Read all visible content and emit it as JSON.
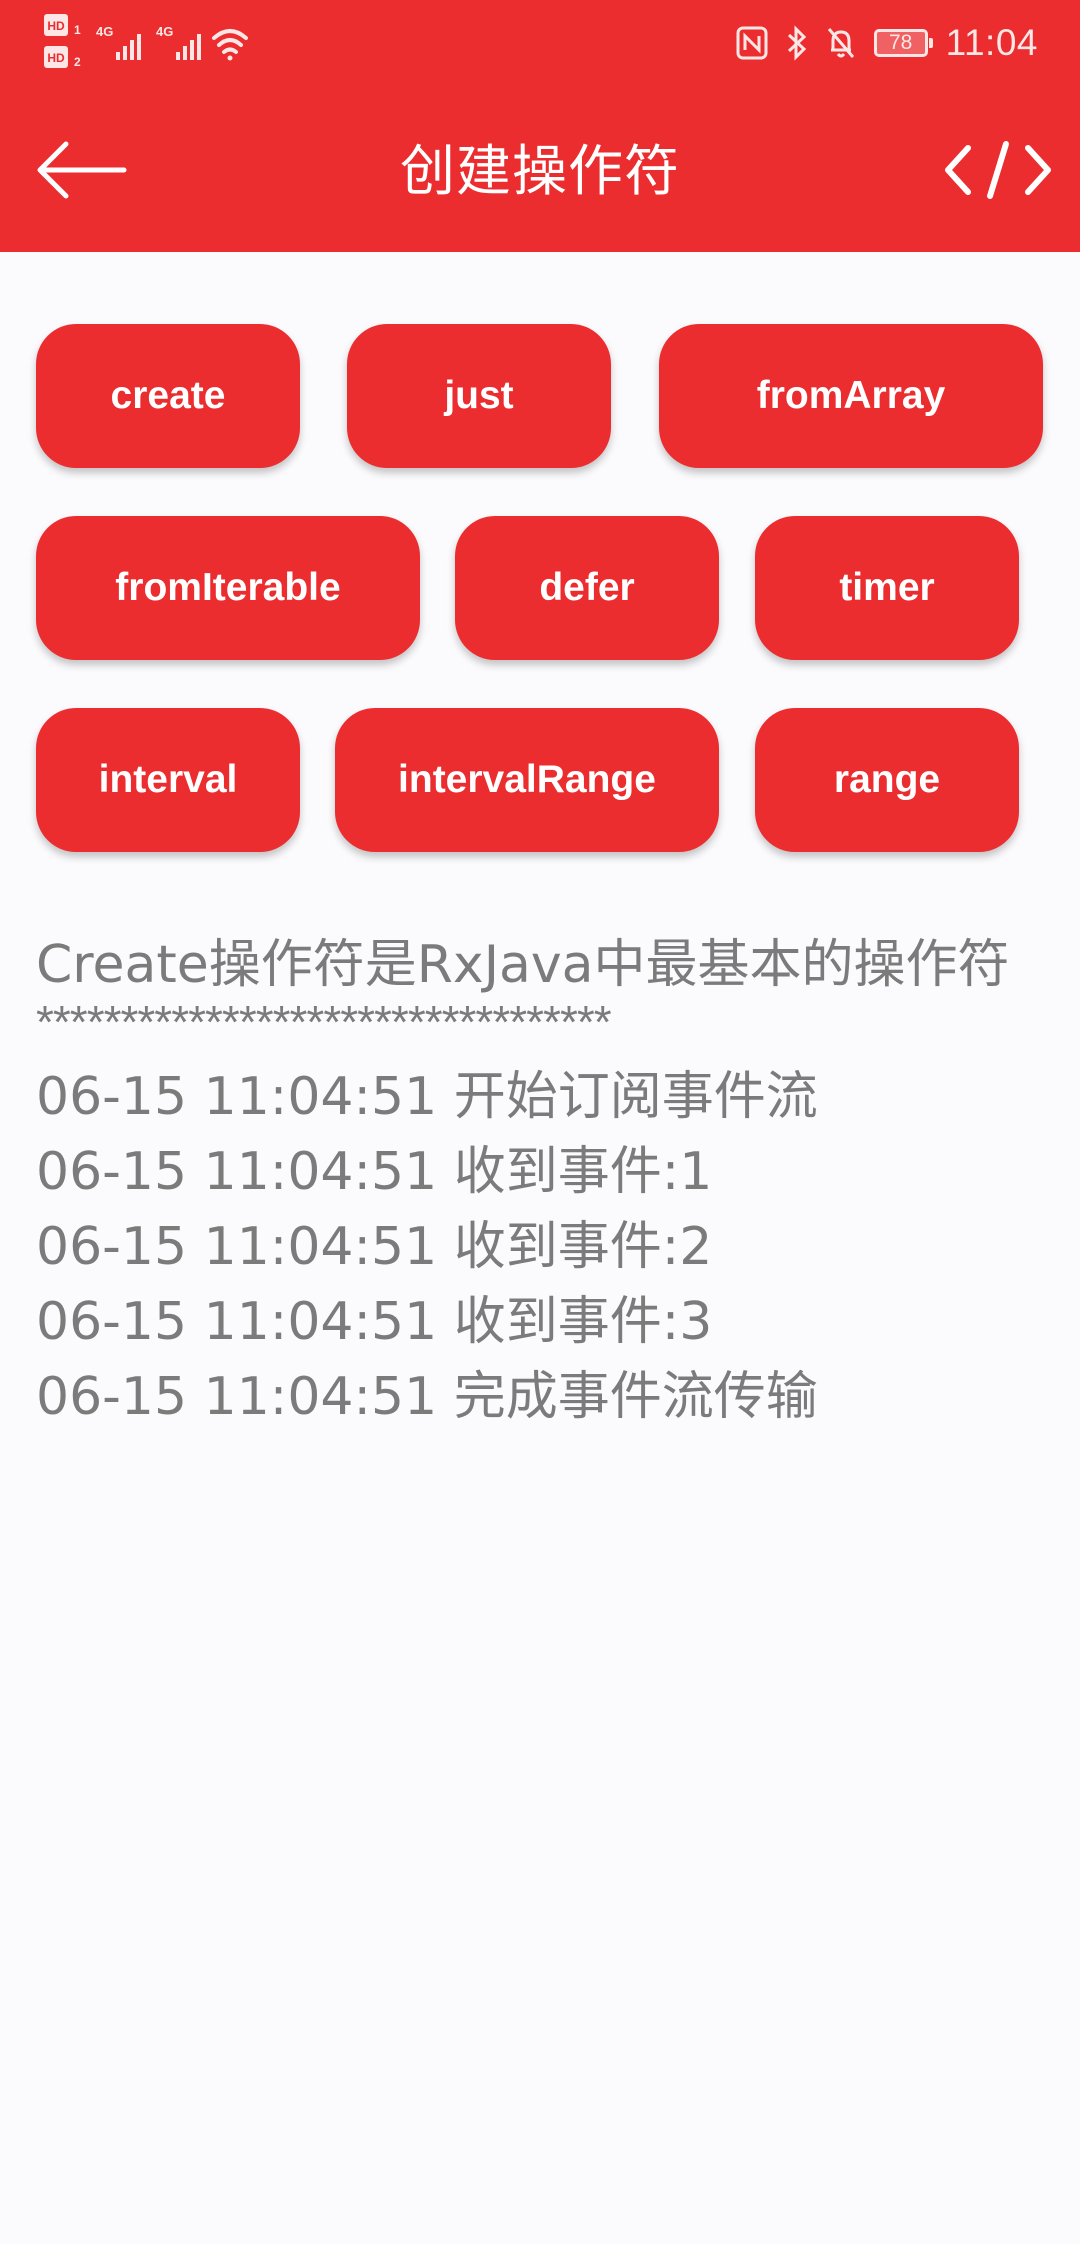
{
  "status_bar": {
    "time": "11:04",
    "battery": "78",
    "sim1_badge": "HD",
    "sim2_badge": "HD",
    "network1": "4G",
    "network2": "4G",
    "icons": [
      "hd-sim1-icon",
      "hd-sim2-icon",
      "signal-4g-icon",
      "signal-4g-icon",
      "wifi-icon",
      "nfc-icon",
      "bluetooth-icon",
      "mute-bell-icon",
      "battery-icon"
    ]
  },
  "toolbar": {
    "title": "创建操作符",
    "back_icon": "back-arrow-icon",
    "code_icon": "code-icon"
  },
  "operators": [
    {
      "label": "create"
    },
    {
      "label": "just"
    },
    {
      "label": "fromArray"
    },
    {
      "label": "fromIterable"
    },
    {
      "label": "defer"
    },
    {
      "label": "timer"
    },
    {
      "label": "interval"
    },
    {
      "label": "intervalRange"
    },
    {
      "label": "range"
    }
  ],
  "content": {
    "description": "Create操作符是RxJava中最基本的操作符",
    "separator": "**********************************",
    "logs": [
      "06-15 11:04:51 开始订阅事件流",
      "06-15 11:04:51 收到事件:1",
      "06-15 11:04:51 收到事件:2",
      "06-15 11:04:51 收到事件:3",
      "06-15 11:04:51 完成事件流传输"
    ]
  },
  "colors": {
    "primary": "#eb2d2f",
    "background": "#fbfafc",
    "text": "#7b7b7b",
    "on_primary": "#ffffff"
  }
}
